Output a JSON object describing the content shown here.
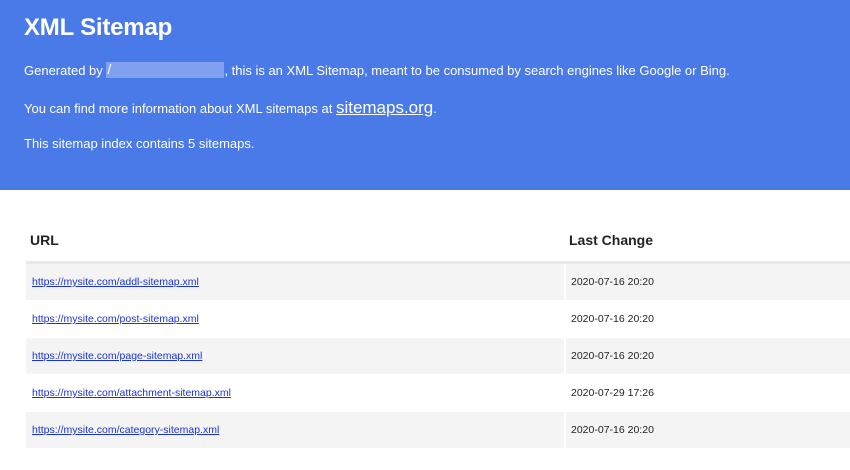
{
  "header": {
    "title": "XML Sitemap",
    "generated_prefix": "Generated by ",
    "generated_redacted": "/",
    "generated_suffix": ", this is an XML Sitemap, meant to be consumed by search engines like Google or Bing.",
    "info_prefix": "You can find more information about XML sitemaps at ",
    "info_link": "sitemaps.org",
    "info_suffix": ".",
    "count_text": "This sitemap index contains 5 sitemaps."
  },
  "table": {
    "columns": [
      "URL",
      "Last Change"
    ],
    "rows": [
      {
        "url": "https://mysite.com/addl-sitemap.xml",
        "last_change": "2020-07-16 20:20"
      },
      {
        "url": "https://mysite.com/post-sitemap.xml",
        "last_change": "2020-07-16 20:20"
      },
      {
        "url": "https://mysite.com/page-sitemap.xml",
        "last_change": "2020-07-16 20:20"
      },
      {
        "url": "https://mysite.com/attachment-sitemap.xml",
        "last_change": "2020-07-29 17:26"
      },
      {
        "url": "https://mysite.com/category-sitemap.xml",
        "last_change": "2020-07-16 20:20"
      }
    ]
  },
  "colors": {
    "header_bg": "#4a79e8",
    "link": "#1a33d6",
    "row_alt": "#f4f4f4"
  }
}
